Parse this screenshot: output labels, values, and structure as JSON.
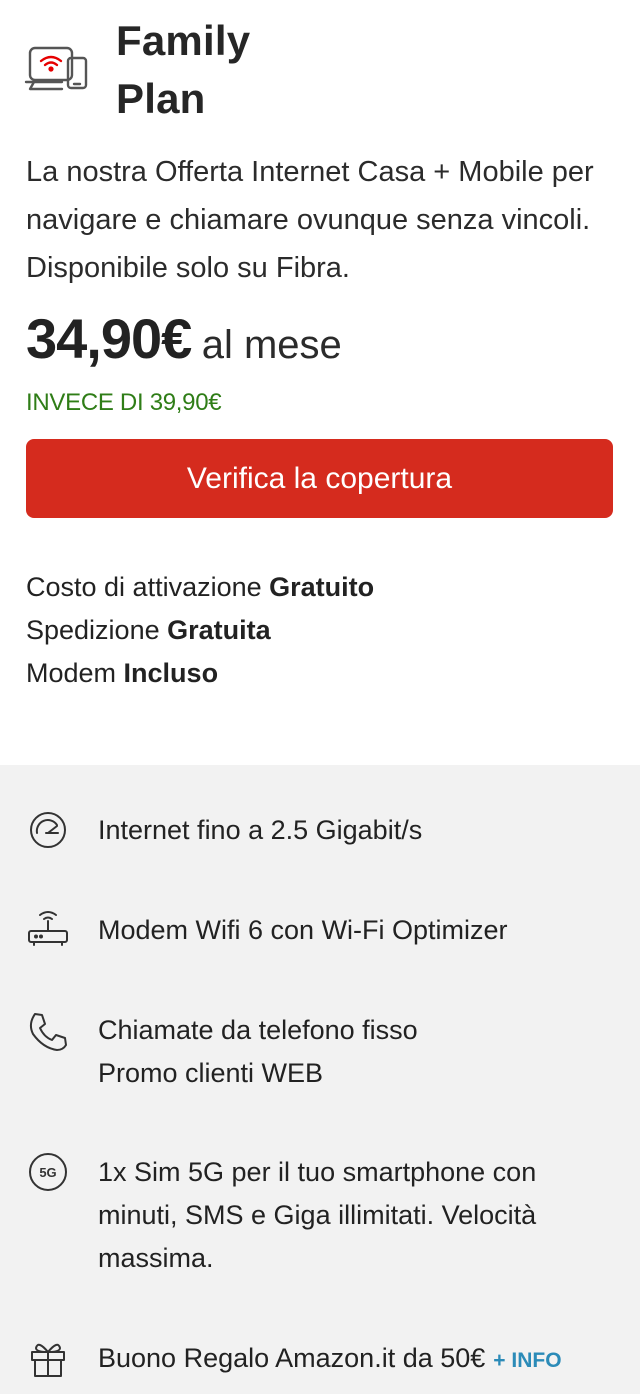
{
  "plan": {
    "title_line1": "Family",
    "title_line2": "Plan",
    "description": "La nostra Offerta Internet Casa + Mobile per navigare e chiamare ovunque senza vincoli. Disponibile solo su Fibra.",
    "price": "34,90€",
    "price_period": "al mese",
    "old_price": "INVECE DI 39,90€",
    "cta_label": "Verifica la copertura"
  },
  "costs": [
    {
      "label": "Costo di attivazione",
      "value": "Gratuito"
    },
    {
      "label": "Spedizione",
      "value": "Gratuita"
    },
    {
      "label": "Modem",
      "value": "Incluso"
    }
  ],
  "features": [
    {
      "icon": "speedometer-icon",
      "lines": [
        "Internet fino a 2.5 Gigabit/s"
      ]
    },
    {
      "icon": "router-icon",
      "lines": [
        "Modem Wifi 6 con Wi-Fi Optimizer"
      ]
    },
    {
      "icon": "phone-icon",
      "lines": [
        "Chiamate da telefono fisso",
        "Promo clienti WEB"
      ]
    },
    {
      "icon": "5g-icon",
      "badge": "5G",
      "lines": [
        "1x Sim 5G per il tuo smartphone con",
        "minuti, SMS e Giga illimitati. Velocità",
        "massima."
      ]
    },
    {
      "icon": "gift-icon",
      "lines": [
        "Buono Regalo Amazon.it da 50€"
      ],
      "link": "+ INFO"
    }
  ],
  "colors": {
    "accent": "#d52b1e",
    "discount": "#2f7d17",
    "link": "#2b8bb8",
    "panel": "#f2f2f2"
  }
}
